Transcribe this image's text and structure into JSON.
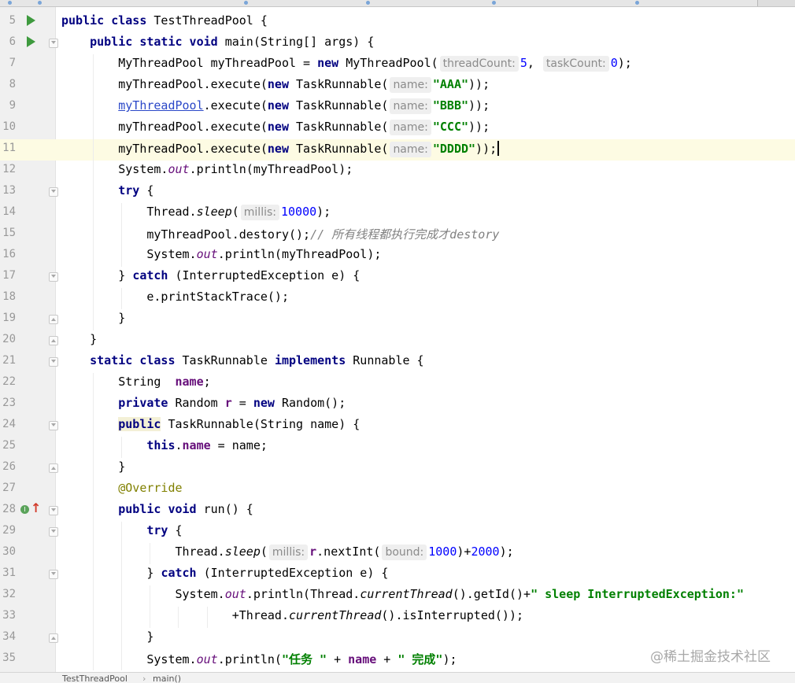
{
  "editor": {
    "current_line": 11,
    "lines": [
      {
        "n": "5",
        "parts": [
          {
            "c": "kw",
            "t": "public class "
          },
          {
            "t": "TestThreadPool {"
          }
        ]
      },
      {
        "n": "6",
        "parts": [
          {
            "t": "    "
          },
          {
            "c": "kw",
            "t": "public static void "
          },
          {
            "t": "main(String[] args) {"
          }
        ]
      },
      {
        "n": "7",
        "parts": [
          {
            "t": "        MyThreadPool myThreadPool = "
          },
          {
            "c": "kw",
            "t": "new "
          },
          {
            "t": "MyThreadPool("
          },
          {
            "c": "hint",
            "t": "threadCount:"
          },
          {
            "c": "num",
            "t": "5"
          },
          {
            "t": ", "
          },
          {
            "c": "hint",
            "t": "taskCount:"
          },
          {
            "c": "num",
            "t": "0"
          },
          {
            "t": ");"
          }
        ]
      },
      {
        "n": "8",
        "parts": [
          {
            "t": "        myThreadPool.execute("
          },
          {
            "c": "kw",
            "t": "new "
          },
          {
            "t": "TaskRunnable("
          },
          {
            "c": "hint",
            "t": "name:"
          },
          {
            "c": "str",
            "t": "\"AAA\""
          },
          {
            "t": "));"
          }
        ]
      },
      {
        "n": "9",
        "parts": [
          {
            "t": "        "
          },
          {
            "c": "link",
            "t": "myThreadPool"
          },
          {
            "t": ".execute("
          },
          {
            "c": "kw",
            "t": "new "
          },
          {
            "t": "TaskRunnable("
          },
          {
            "c": "hint",
            "t": "name:"
          },
          {
            "c": "str",
            "t": "\"BBB\""
          },
          {
            "t": "));"
          }
        ]
      },
      {
        "n": "10",
        "parts": [
          {
            "t": "        myThreadPool.execute("
          },
          {
            "c": "kw",
            "t": "new "
          },
          {
            "t": "TaskRunnable("
          },
          {
            "c": "hint",
            "t": "name:"
          },
          {
            "c": "str",
            "t": "\"CCC\""
          },
          {
            "t": "));"
          }
        ]
      },
      {
        "n": "11",
        "parts": [
          {
            "t": "        myThreadPool.execute("
          },
          {
            "c": "kw",
            "t": "new "
          },
          {
            "t": "TaskRunnable("
          },
          {
            "c": "hint",
            "t": "name:"
          },
          {
            "c": "str",
            "t": "\"DDDD\""
          },
          {
            "t": "));"
          },
          {
            "c": "caret",
            "t": ""
          }
        ]
      },
      {
        "n": "12",
        "parts": [
          {
            "t": "        System."
          },
          {
            "c": "sfld",
            "t": "out"
          },
          {
            "t": ".println(myThreadPool);"
          }
        ]
      },
      {
        "n": "13",
        "parts": [
          {
            "t": "        "
          },
          {
            "c": "kw",
            "t": "try "
          },
          {
            "t": "{"
          }
        ]
      },
      {
        "n": "14",
        "parts": [
          {
            "t": "            Thread."
          },
          {
            "c": "meth-i",
            "t": "sleep"
          },
          {
            "t": "("
          },
          {
            "c": "hint",
            "t": "millis:"
          },
          {
            "c": "num",
            "t": "10000"
          },
          {
            "t": ");"
          }
        ]
      },
      {
        "n": "15",
        "parts": [
          {
            "t": "            myThreadPool.destory();"
          },
          {
            "c": "cmt",
            "t": "// 所有线程都执行完成才destory"
          }
        ]
      },
      {
        "n": "16",
        "parts": [
          {
            "t": "            System."
          },
          {
            "c": "sfld",
            "t": "out"
          },
          {
            "t": ".println(myThreadPool);"
          }
        ]
      },
      {
        "n": "17",
        "parts": [
          {
            "t": "        } "
          },
          {
            "c": "kw",
            "t": "catch "
          },
          {
            "t": "(InterruptedException e) {"
          }
        ]
      },
      {
        "n": "18",
        "parts": [
          {
            "t": "            e.printStackTrace();"
          }
        ]
      },
      {
        "n": "19",
        "parts": [
          {
            "t": "        }"
          }
        ]
      },
      {
        "n": "20",
        "parts": [
          {
            "t": "    }"
          }
        ]
      },
      {
        "n": "21",
        "parts": [
          {
            "t": "    "
          },
          {
            "c": "kw",
            "t": "static class "
          },
          {
            "t": "TaskRunnable "
          },
          {
            "c": "kw",
            "t": "implements "
          },
          {
            "t": "Runnable {"
          }
        ]
      },
      {
        "n": "22",
        "parts": [
          {
            "t": "        String  "
          },
          {
            "c": "fld",
            "t": "name"
          },
          {
            "t": ";"
          }
        ]
      },
      {
        "n": "23",
        "parts": [
          {
            "t": "        "
          },
          {
            "c": "kw",
            "t": "private "
          },
          {
            "t": "Random "
          },
          {
            "c": "fld",
            "t": "r"
          },
          {
            "t": " = "
          },
          {
            "c": "kw",
            "t": "new "
          },
          {
            "t": "Random();"
          }
        ]
      },
      {
        "n": "24",
        "parts": [
          {
            "t": "        "
          },
          {
            "c": "kw hl-word",
            "t": "public"
          },
          {
            "t": " TaskRunnable(String name) {"
          }
        ]
      },
      {
        "n": "25",
        "parts": [
          {
            "t": "            "
          },
          {
            "c": "kw",
            "t": "this"
          },
          {
            "t": "."
          },
          {
            "c": "fld",
            "t": "name"
          },
          {
            "t": " = name;"
          }
        ]
      },
      {
        "n": "26",
        "parts": [
          {
            "t": "        }"
          }
        ]
      },
      {
        "n": "27",
        "parts": [
          {
            "t": "        "
          },
          {
            "c": "anno",
            "t": "@Override"
          }
        ]
      },
      {
        "n": "28",
        "parts": [
          {
            "t": "        "
          },
          {
            "c": "kw",
            "t": "public void "
          },
          {
            "t": "run() {"
          }
        ]
      },
      {
        "n": "29",
        "parts": [
          {
            "t": "            "
          },
          {
            "c": "kw",
            "t": "try "
          },
          {
            "t": "{"
          }
        ]
      },
      {
        "n": "30",
        "parts": [
          {
            "t": "                Thread."
          },
          {
            "c": "meth-i",
            "t": "sleep"
          },
          {
            "t": "("
          },
          {
            "c": "hint",
            "t": "millis:"
          },
          {
            "c": "fld",
            "t": "r"
          },
          {
            "t": ".nextInt("
          },
          {
            "c": "hint",
            "t": "bound:"
          },
          {
            "c": "num",
            "t": "1000"
          },
          {
            "t": ")+"
          },
          {
            "c": "num",
            "t": "2000"
          },
          {
            "t": ");"
          }
        ]
      },
      {
        "n": "31",
        "parts": [
          {
            "t": "            } "
          },
          {
            "c": "kw",
            "t": "catch "
          },
          {
            "t": "(InterruptedException e) {"
          }
        ]
      },
      {
        "n": "32",
        "parts": [
          {
            "t": "                System."
          },
          {
            "c": "sfld",
            "t": "out"
          },
          {
            "t": ".println(Thread."
          },
          {
            "c": "meth-i",
            "t": "currentThread"
          },
          {
            "t": "().getId()+"
          },
          {
            "c": "str",
            "t": "\" sleep InterruptedException:\""
          }
        ]
      },
      {
        "n": "33",
        "parts": [
          {
            "t": "                        +Thread."
          },
          {
            "c": "meth-i",
            "t": "currentThread"
          },
          {
            "t": "().isInterrupted());"
          }
        ]
      },
      {
        "n": "34",
        "parts": [
          {
            "t": "            }"
          }
        ]
      },
      {
        "n": "35",
        "parts": [
          {
            "t": "            System."
          },
          {
            "c": "sfld",
            "t": "out"
          },
          {
            "t": ".println("
          },
          {
            "c": "str",
            "t": "\"任务 \""
          },
          {
            "t": " + "
          },
          {
            "c": "fld",
            "t": "name"
          },
          {
            "t": " + "
          },
          {
            "c": "str",
            "t": "\" 完成\""
          },
          {
            "t": ");"
          }
        ]
      }
    ],
    "run_lines": [
      "5",
      "6"
    ],
    "implements_marker_line": "28",
    "implements_marker_label": "I",
    "fold_open_lines": [
      "6",
      "13",
      "17",
      "21",
      "24",
      "28",
      "29",
      "31"
    ],
    "fold_close_lines": [
      "19",
      "20",
      "26",
      "34"
    ]
  },
  "breadcrumb": {
    "items": [
      "TestThreadPool",
      "main()"
    ],
    "separator": "›"
  },
  "watermark": "@稀土掘金技术社区",
  "colors": {
    "keyword": "#000080",
    "string": "#008000",
    "number": "#0000ff",
    "field": "#660e7a",
    "annotation": "#808000",
    "comment": "#808080",
    "current_line": "#fdfbe3"
  },
  "icons": {
    "run": "run-gutter-icon",
    "implements": "implements-method-icon",
    "fold": "fold-marker-icon"
  }
}
